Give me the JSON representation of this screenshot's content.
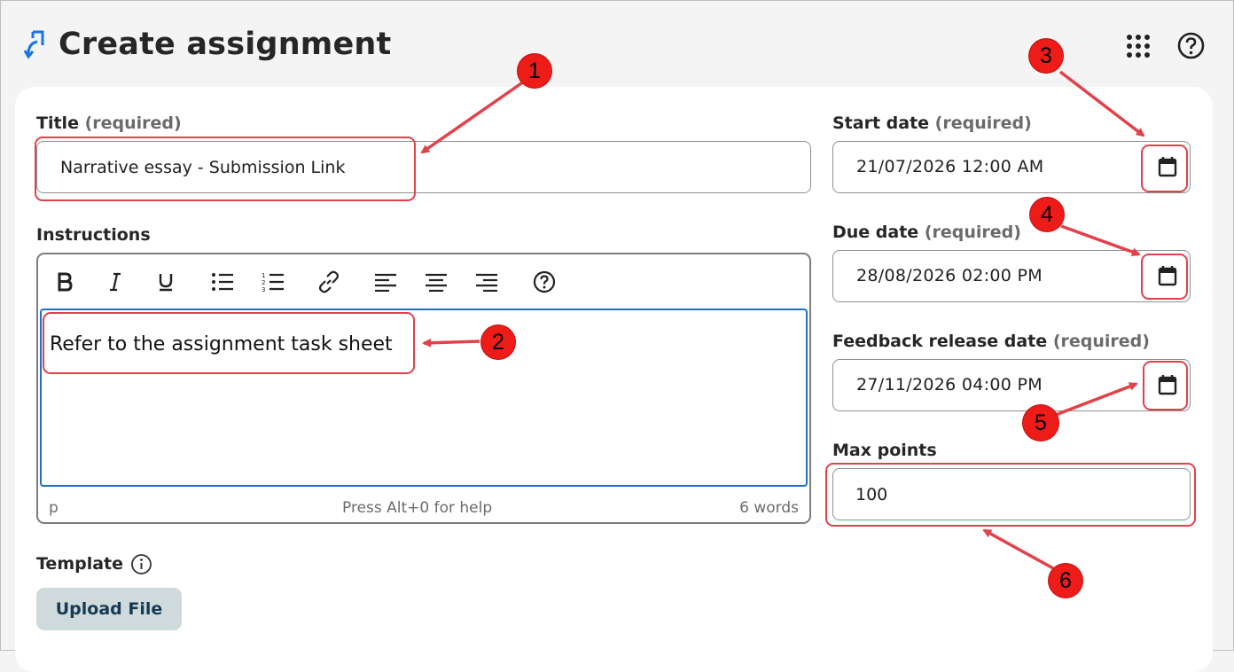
{
  "header": {
    "title": "Create assignment",
    "icons": {
      "logo": "assignment-link-icon",
      "apps": "apps-grid-icon",
      "help": "help-circle-icon"
    },
    "accent_color": "#1a73e8"
  },
  "form": {
    "title": {
      "label": "Title",
      "required": "(required)",
      "value": "Narrative essay - Submission Link"
    },
    "instructions": {
      "label": "Instructions",
      "toolbar": [
        "bold",
        "italic",
        "underline",
        "bulleted-list",
        "numbered-list",
        "link",
        "align-left",
        "align-center",
        "align-right",
        "help"
      ],
      "content": "Refer to the assignment task sheet",
      "status_left": "p",
      "status_center": "Press Alt+0 for help",
      "status_right": "6 words"
    },
    "template": {
      "label": "Template",
      "upload_label": "Upload File"
    },
    "start_date": {
      "label": "Start date",
      "required": "(required)",
      "value": "21/07/2026 12:00 AM"
    },
    "due_date": {
      "label": "Due date",
      "required": "(required)",
      "value": "28/08/2026 02:00 PM"
    },
    "feedback_date": {
      "label": "Feedback release date",
      "required": "(required)",
      "value": "27/11/2026 04:00 PM"
    },
    "max_points": {
      "label": "Max points",
      "value": "100"
    }
  },
  "annotations": {
    "color": "#e2414a",
    "badges": [
      "1",
      "2",
      "3",
      "4",
      "5",
      "6"
    ]
  }
}
